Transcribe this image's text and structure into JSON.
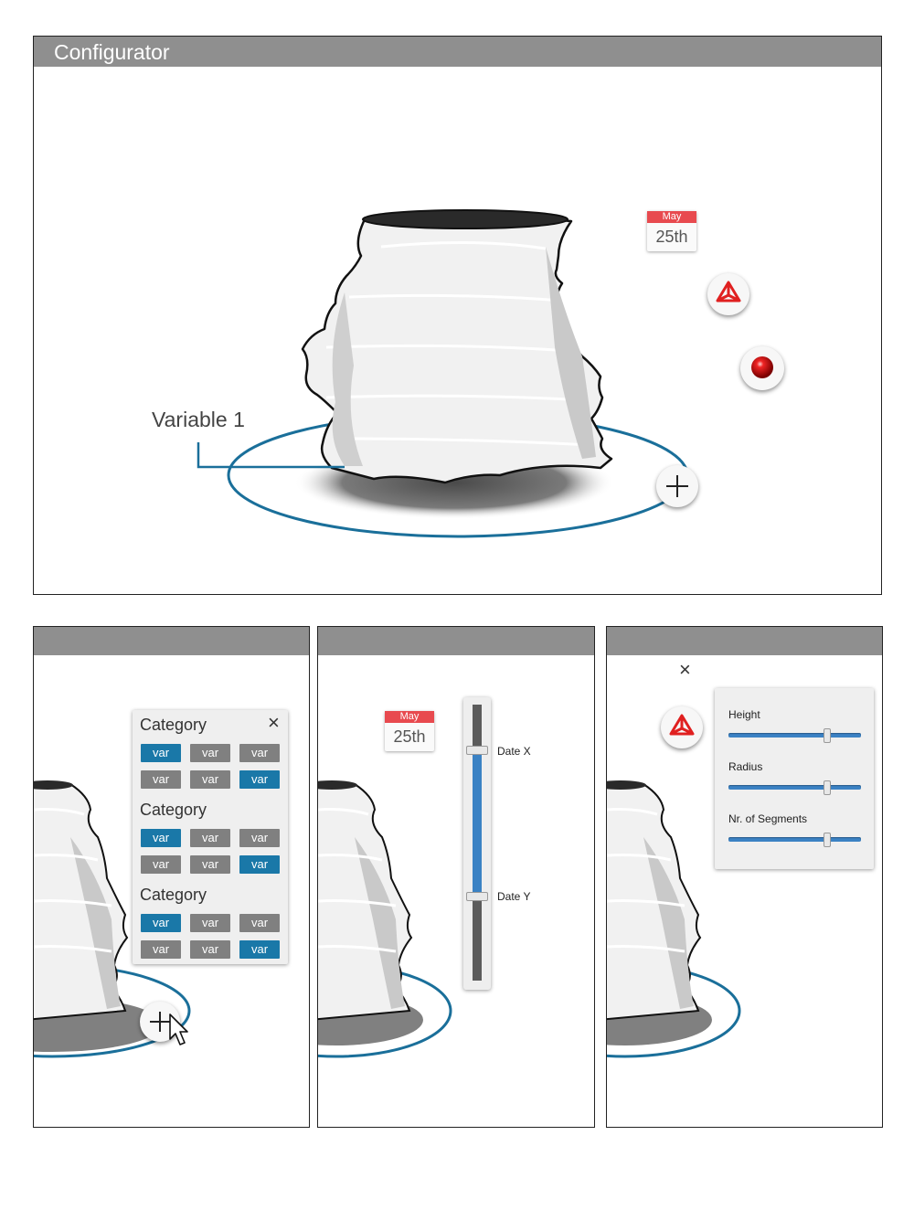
{
  "main": {
    "title": "Configurator",
    "variable_label": "Variable 1",
    "calendar": {
      "month": "May",
      "day": "25th"
    }
  },
  "panel_category": {
    "close": "×",
    "categories": [
      {
        "title": "Category",
        "chips": [
          {
            "label": "var",
            "on": true
          },
          {
            "label": "var",
            "on": false
          },
          {
            "label": "var",
            "on": false
          },
          {
            "label": "var",
            "on": false
          },
          {
            "label": "var",
            "on": false
          },
          {
            "label": "var",
            "on": true
          }
        ]
      },
      {
        "title": "Category",
        "chips": [
          {
            "label": "var",
            "on": true
          },
          {
            "label": "var",
            "on": false
          },
          {
            "label": "var",
            "on": false
          },
          {
            "label": "var",
            "on": false
          },
          {
            "label": "var",
            "on": false
          },
          {
            "label": "var",
            "on": true
          }
        ]
      },
      {
        "title": "Category",
        "chips": [
          {
            "label": "var",
            "on": true
          },
          {
            "label": "var",
            "on": false
          },
          {
            "label": "var",
            "on": false
          },
          {
            "label": "var",
            "on": false
          },
          {
            "label": "var",
            "on": false
          },
          {
            "label": "var",
            "on": true
          }
        ]
      }
    ]
  },
  "panel_date": {
    "calendar": {
      "month": "May",
      "day": "25th"
    },
    "date_x_label": "Date X",
    "date_y_label": "Date Y"
  },
  "panel_params": {
    "close": "×",
    "sliders": [
      {
        "label": "Height",
        "value": 0.74
      },
      {
        "label": "Radius",
        "value": 0.74
      },
      {
        "label": "Nr. of Segments",
        "value": 0.74
      }
    ]
  },
  "colors": {
    "accent": "#1a78a8",
    "titlebar": "#8f8f8f",
    "calendar_red": "#e84a4f",
    "slider_blue": "#3b82c4"
  },
  "icons": [
    "cube-icon",
    "record-ball-icon",
    "plus-icon",
    "cursor-icon",
    "close-icon"
  ]
}
